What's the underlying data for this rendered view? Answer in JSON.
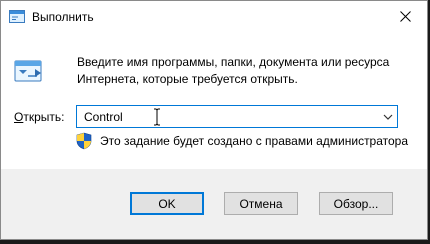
{
  "window": {
    "title": "Выполнить",
    "description": "Введите имя программы, папки, документа или ресурса Интернета, которые требуется открыть.",
    "open_label_prefix": "О",
    "open_label_rest": "ткрыть:",
    "open_value": "Control",
    "admin_note": "Это задание будет создано с правами администратора",
    "colors": {
      "accent": "#0078d7",
      "background": "#f0f0f0",
      "content": "#ffffff"
    },
    "icons": [
      "run-icon",
      "close-icon",
      "shield-icon",
      "chevron-down-icon",
      "text-cursor-icon"
    ]
  },
  "buttons": {
    "ok": "OK",
    "cancel": "Отмена",
    "browse": "Обзор..."
  }
}
